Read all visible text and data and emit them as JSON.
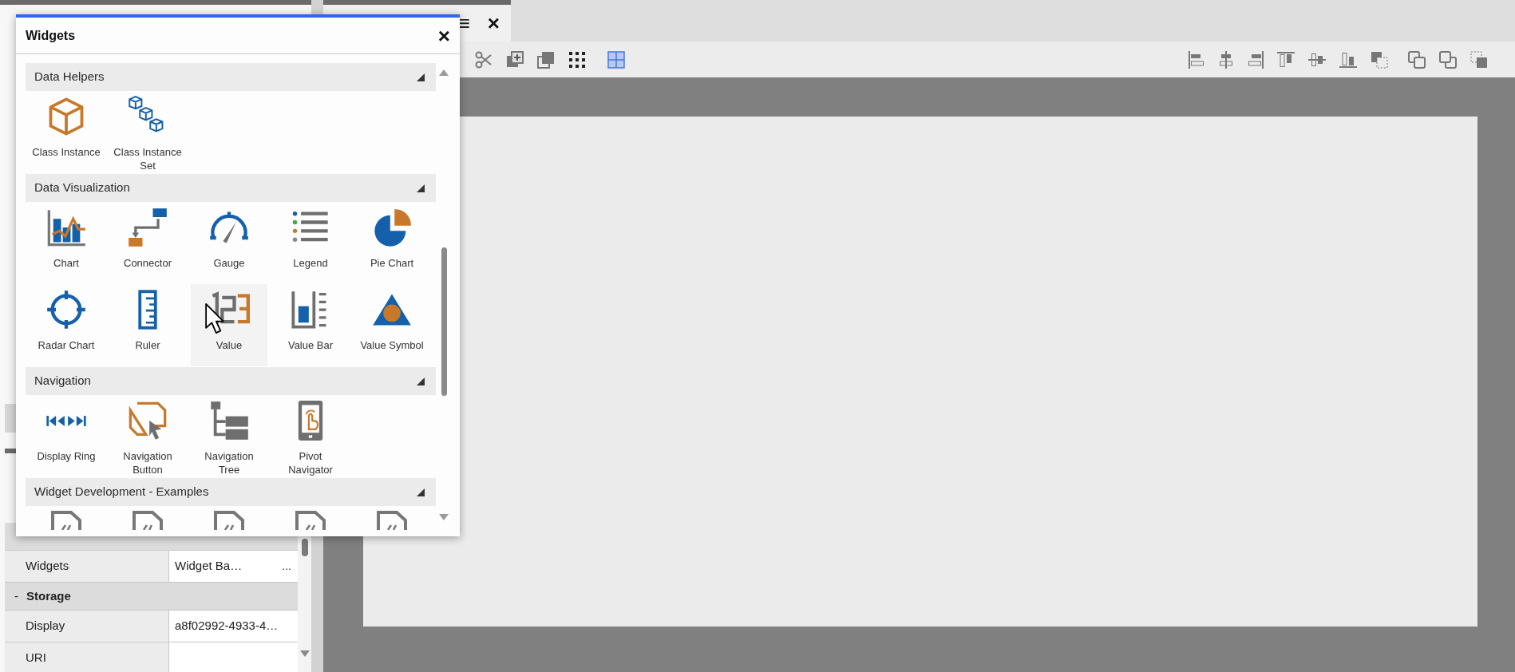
{
  "tab": {
    "menu": "≡",
    "close": "×"
  },
  "properties": {
    "sections": [
      {
        "rows": [
          {
            "label": "Widgets",
            "value": "Widget Ba…",
            "button": "..."
          }
        ]
      },
      {
        "toggle": "-",
        "title": "Storage",
        "rows": [
          {
            "label": "Display",
            "value": "a8f02992-4933-4…"
          },
          {
            "label": "URI"
          }
        ]
      }
    ]
  },
  "dialog": {
    "title": "Widgets",
    "close": "×",
    "sections": [
      {
        "title": "Data Helpers",
        "expanded": true,
        "items": [
          {
            "kind": "widget",
            "label": "Class Instance",
            "hovered": false
          },
          {
            "kind": "widget",
            "label": "Class Instance Set",
            "hovered": false
          }
        ]
      },
      {
        "title": "Data Visualization",
        "expanded": true,
        "items": [
          {
            "kind": "widget",
            "label": "Chart",
            "hovered": false
          },
          {
            "kind": "widget",
            "label": "Connector",
            "hovered": false
          },
          {
            "kind": "widget",
            "label": "Gauge",
            "hovered": false
          },
          {
            "kind": "widget",
            "label": "Legend",
            "hovered": false
          },
          {
            "kind": "widget",
            "label": "Pie Chart",
            "hovered": false
          },
          {
            "kind": "widget",
            "label": "Radar Chart",
            "hovered": false
          },
          {
            "kind": "widget",
            "label": "Ruler",
            "hovered": false
          },
          {
            "kind": "widget",
            "label": "Value",
            "hovered": true
          },
          {
            "kind": "widget",
            "label": "Value Bar",
            "hovered": false
          },
          {
            "kind": "widget",
            "label": "Value Symbol",
            "hovered": false
          }
        ]
      },
      {
        "title": "Navigation",
        "expanded": true,
        "items": [
          {
            "kind": "widget",
            "label": "Display Ring",
            "hovered": false
          },
          {
            "kind": "widget",
            "label": "Navigation Button",
            "hovered": false
          },
          {
            "kind": "widget",
            "label": "Navigation Tree",
            "hovered": false
          },
          {
            "kind": "widget",
            "label": "Pivot Navigator",
            "hovered": false
          }
        ]
      },
      {
        "title": "Widget Development - Examples",
        "expanded": true,
        "items": [
          {
            "kind": "file",
            "hovered": false
          },
          {
            "kind": "file",
            "hovered": false
          },
          {
            "kind": "file",
            "hovered": false
          },
          {
            "kind": "file",
            "hovered": false
          },
          {
            "kind": "file",
            "hovered": false
          }
        ]
      }
    ]
  }
}
